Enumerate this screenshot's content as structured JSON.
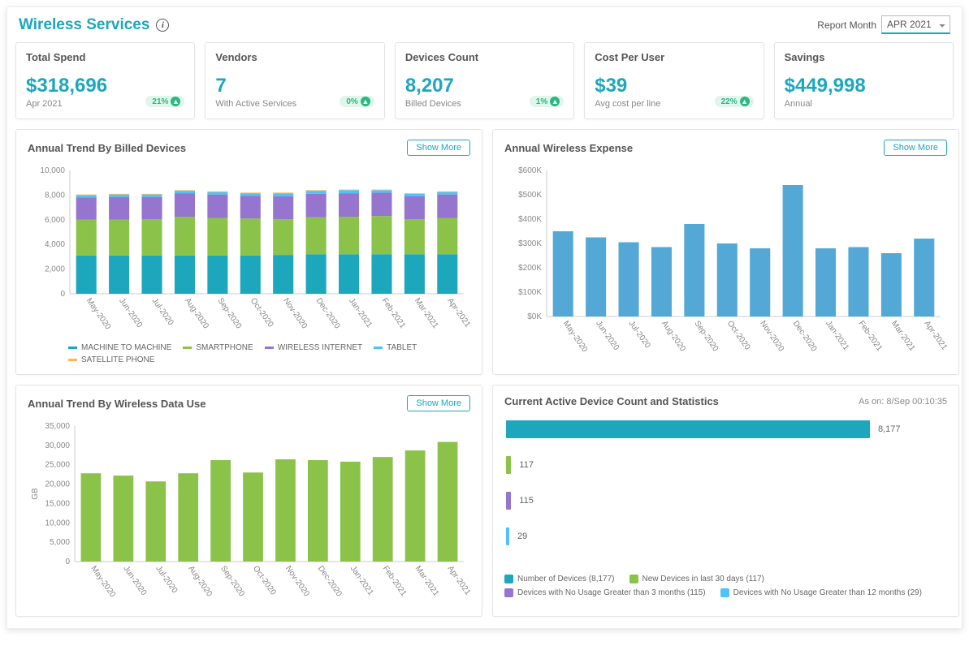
{
  "header": {
    "title": "Wireless Services",
    "report_month_label": "Report Month",
    "report_month_value": "APR 2021"
  },
  "kpis": [
    {
      "title": "Total Spend",
      "value": "$318,696",
      "sub": "Apr 2021",
      "pct": "21%"
    },
    {
      "title": "Vendors",
      "value": "7",
      "sub": "With Active Services",
      "pct": "0%"
    },
    {
      "title": "Devices Count",
      "value": "8,207",
      "sub": "Billed Devices",
      "pct": "1%"
    },
    {
      "title": "Cost Per User",
      "value": "$39",
      "sub": "Avg cost per line",
      "pct": "22%"
    },
    {
      "title": "Savings",
      "value": "$449,998",
      "sub": "Annual"
    }
  ],
  "labels": {
    "show_more": "Show More"
  },
  "colors": {
    "teal": "#1ca7bc",
    "green": "#8bc34a",
    "purple": "#9575cd",
    "blue": "#4fc3f7",
    "orange": "#ffb74d",
    "bar_blue": "#54a8d6"
  },
  "c1": {
    "title": "Annual Trend By Billed Devices"
  },
  "c2": {
    "title": "Annual Wireless Expense"
  },
  "c3": {
    "title": "Annual Trend By Wireless Data Use"
  },
  "c4": {
    "title": "Current Active Device Count and Statistics",
    "as_on": "As on: 8/Sep 00:10:35"
  },
  "chart_data": [
    {
      "id": "billed_devices",
      "type": "bar_stacked",
      "title": "Annual Trend By Billed Devices",
      "ylabel": "",
      "ylim": [
        0,
        10000
      ],
      "yticks": [
        0,
        2000,
        4000,
        6000,
        8000,
        10000
      ],
      "categories": [
        "May-2020",
        "Jun-2020",
        "Jul-2020",
        "Aug-2020",
        "Sep-2020",
        "Oct-2020",
        "Nov-2020",
        "Dec-2020",
        "Jan-2021",
        "Feb-2021",
        "Mar-2021",
        "Apr-2021"
      ],
      "series": [
        {
          "name": "MACHINE TO MACHINE",
          "color": "#1ca7bc",
          "values": [
            3100,
            3100,
            3100,
            3100,
            3100,
            3100,
            3150,
            3200,
            3200,
            3200,
            3200,
            3200
          ]
        },
        {
          "name": "SMARTPHONE",
          "color": "#8bc34a",
          "values": [
            2900,
            2900,
            2950,
            3150,
            3050,
            3000,
            2900,
            3000,
            3050,
            3100,
            2850,
            2950
          ]
        },
        {
          "name": "WIRELESS INTERNET",
          "color": "#9575cd",
          "values": [
            1800,
            1850,
            1800,
            1900,
            1900,
            1850,
            1850,
            1900,
            1900,
            1900,
            1850,
            1900
          ]
        },
        {
          "name": "TABLET",
          "color": "#4fc3f7",
          "values": [
            200,
            200,
            200,
            200,
            200,
            200,
            250,
            250,
            250,
            200,
            200,
            200
          ]
        },
        {
          "name": "SATELLITE PHONE",
          "color": "#ffb74d",
          "values": [
            50,
            50,
            50,
            50,
            50,
            50,
            50,
            50,
            50,
            50,
            50,
            50
          ]
        }
      ]
    },
    {
      "id": "wireless_expense",
      "type": "bar",
      "title": "Annual Wireless Expense",
      "ylabel": "",
      "ylim": [
        0,
        600000
      ],
      "yticks": [
        "$0K",
        "$100K",
        "$200K",
        "$300K",
        "$400K",
        "$500K",
        "$600K"
      ],
      "categories": [
        "May-2020",
        "Jun-2020",
        "Jul-2020",
        "Aug-2020",
        "Sep-2020",
        "Oct-2020",
        "Nov-2020",
        "Dec-2020",
        "Jan-2021",
        "Feb-2021",
        "Mar-2021",
        "Apr-2021"
      ],
      "values": [
        350000,
        325000,
        305000,
        285000,
        380000,
        300000,
        280000,
        540000,
        280000,
        285000,
        260000,
        320000
      ],
      "color": "#54a8d6"
    },
    {
      "id": "data_use",
      "type": "bar",
      "title": "Annual Trend By Wireless Data Use",
      "ylabel": "GB",
      "ylim": [
        0,
        35000
      ],
      "yticks": [
        0,
        5000,
        10000,
        15000,
        20000,
        25000,
        30000,
        35000
      ],
      "categories": [
        "May-2020",
        "Jun-2020",
        "Jul-2020",
        "Aug-2020",
        "Sep-2020",
        "Oct-2020",
        "Nov-2020",
        "Dec-2020",
        "Jan-2021",
        "Feb-2021",
        "Mar-2021",
        "Apr-2021"
      ],
      "values": [
        22800,
        22200,
        20700,
        22800,
        26200,
        23000,
        26400,
        26200,
        25800,
        27000,
        28700,
        30900
      ],
      "color": "#8bc34a"
    },
    {
      "id": "active_devices",
      "type": "bar_horizontal",
      "title": "Current Active Device Count and Statistics",
      "max": 8177,
      "items": [
        {
          "label": "Number of Devices (8,177)",
          "value": 8177,
          "display": "8,177",
          "color": "#1ca7bc"
        },
        {
          "label": "New Devices in last 30 days (117)",
          "value": 117,
          "display": "117",
          "color": "#8bc34a"
        },
        {
          "label": "Devices with No Usage Greater than 3 months (115)",
          "value": 115,
          "display": "115",
          "color": "#9575cd"
        },
        {
          "label": "Devices with No Usage Greater than 12 months (29)",
          "value": 29,
          "display": "29",
          "color": "#4fc3f7"
        }
      ]
    }
  ]
}
